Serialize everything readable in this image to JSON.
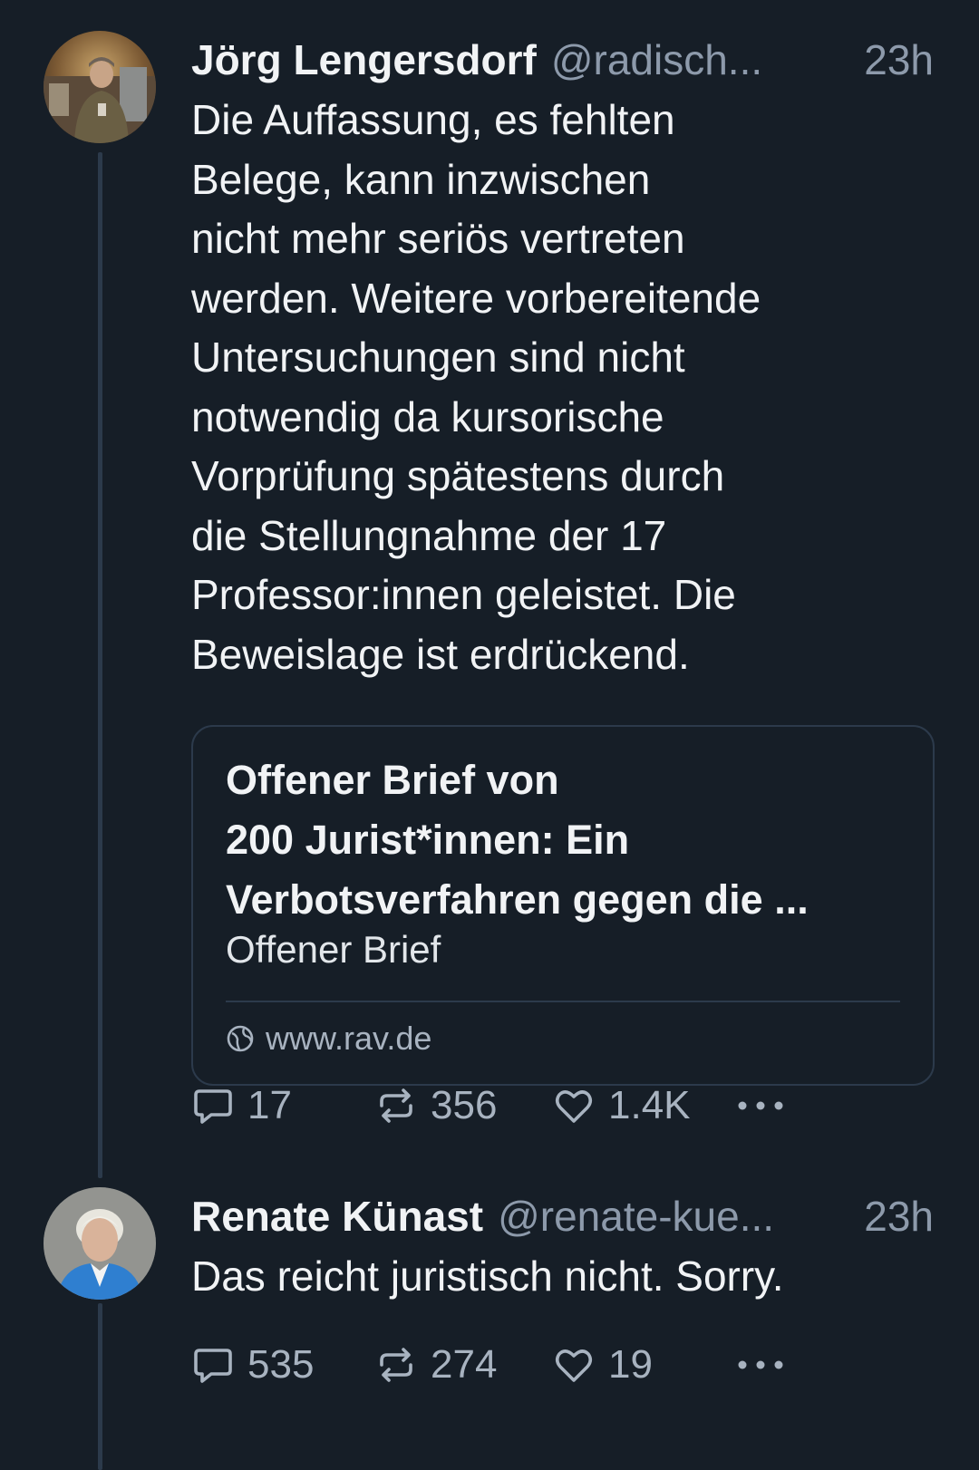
{
  "posts": [
    {
      "author": "Jörg Lengersdorf",
      "handle": "@radisch...",
      "time": "23h",
      "text_lines": [
        "Die Auffassung, es fehlten",
        "Belege, kann inzwischen",
        "nicht mehr seriös vertreten",
        "werden. Weitere vorbereitende",
        "Untersuchungen sind nicht",
        "notwendig da kursorische",
        "Vorprüfung spätestens durch",
        "die Stellungnahme der 17",
        "Professor:innen geleistet. Die",
        "Beweislage ist erdrückend."
      ],
      "link_card": {
        "title_lines": [
          "Offener Brief von",
          "200 Jurist*innen: Ein",
          "Verbotsverfahren gegen die ..."
        ],
        "description": "Offener Brief",
        "domain": "www.rav.de",
        "domain_icon": "globe-icon"
      },
      "replies": "17",
      "reposts": "356",
      "likes": "1.4K"
    },
    {
      "author": "Renate Künast",
      "handle": "@renate-kue...",
      "time": "23h",
      "text_lines": [
        "Das reicht juristisch nicht. Sorry."
      ],
      "replies": "535",
      "reposts": "274",
      "likes": "19"
    }
  ],
  "icons": {
    "reply": "reply-bubble-icon",
    "repost": "repost-icon",
    "like": "heart-icon",
    "more": "more-dots-icon"
  },
  "colors": {
    "background": "#161e27",
    "text": "#f1f3f5",
    "muted": "#8d9aab",
    "border": "#2c3a4b"
  }
}
